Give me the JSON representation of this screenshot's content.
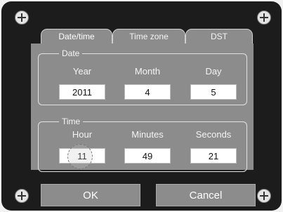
{
  "tabs": [
    {
      "label": "Date/time",
      "active": true
    },
    {
      "label": "Time zone",
      "active": false
    },
    {
      "label": "DST",
      "active": false
    }
  ],
  "date_group": {
    "title": "Date",
    "fields": [
      {
        "label": "Year",
        "value": "2011"
      },
      {
        "label": "Month",
        "value": "4"
      },
      {
        "label": "Day",
        "value": "5"
      }
    ]
  },
  "time_group": {
    "title": "Time",
    "fields": [
      {
        "label": "Hour",
        "value": "11"
      },
      {
        "label": "Minutes",
        "value": "49"
      },
      {
        "label": "Seconds",
        "value": "21"
      }
    ]
  },
  "buttons": {
    "ok": "OK",
    "cancel": "Cancel"
  },
  "colors": {
    "bezel": "#1c1c1c",
    "panel": "#8c8c8c",
    "field": "#ffffff"
  },
  "icons": [
    "screw-icon"
  ]
}
